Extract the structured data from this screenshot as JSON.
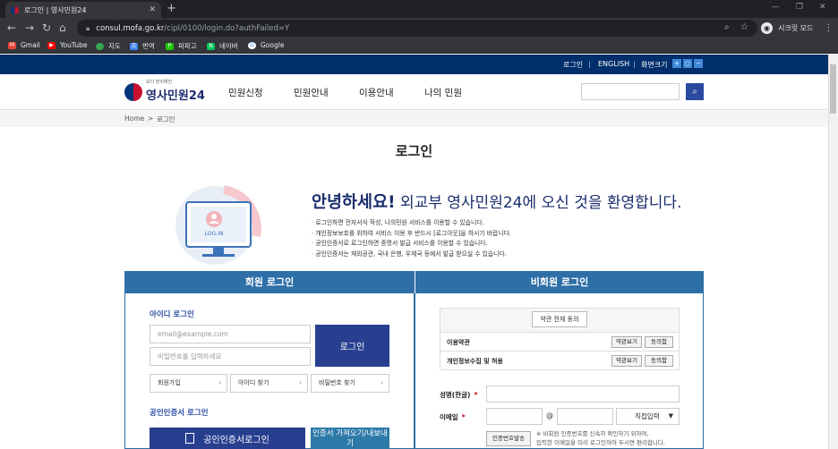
{
  "browser": {
    "tab_title": "로그인 | 영사민원24",
    "url_host": "consul.mofa.go.kr",
    "url_path": "/cipl/0100/login.do?authFailed=Y",
    "incognito_label": "시크릿 모드",
    "bookmarks": [
      "Gmail",
      "YouTube",
      "지도",
      "번역",
      "파파고",
      "네이버",
      "Google"
    ]
  },
  "util": {
    "login": "로그인",
    "english": "ENGLISH",
    "zoom": "화면크기",
    "sep": "|"
  },
  "header": {
    "logo_small": "보다 편리해진",
    "logo_text": "영사민원24",
    "nav": [
      "민원신청",
      "민원안내",
      "이용안내",
      "나의 민원"
    ]
  },
  "breadcrumb": {
    "home": "Home",
    "sep": ">",
    "current": "로그인"
  },
  "page_title": "로그인",
  "intro": {
    "illus_label": "LOG-IN",
    "hello": "안녕하세요!",
    "welcome_rest": " 외교부 영사민원24에 오신 것을 환영합니다.",
    "notes": [
      "로그인하면 전자서식 작성, 나의민원 서비스를 이용할 수 있습니다.",
      "개인정보보호를 위하여 서비스 이용 후 반드시 [로그아웃]을 하시기 바랍니다.",
      "공인인증서로 로그인하면 증명서 발급 서비스를 이용할 수 있습니다.",
      "공인인증서는 재외공관, 국내 은행, 우체국 등에서 발급 받으실 수 있습니다."
    ]
  },
  "member": {
    "heading": "회원 로그인",
    "id_login_title": "아이디 로그인",
    "id_placeholder": "email@example.com",
    "pw_placeholder": "비밀번호를 입력하세요",
    "login_button": "로그인",
    "links": [
      "회원가입",
      "아이디 찾기",
      "비밀번호 찾기"
    ],
    "cert_title": "공인인증서 로그인",
    "cert_button": "공인인증서로그인",
    "cert_button2": "인증서 가져오기/내보내기"
  },
  "guest": {
    "heading": "비회원 로그인",
    "agree_all": "약관 전체 동의",
    "terms": [
      {
        "label": "이용약관",
        "view": "약관보기",
        "agree": "동의함"
      },
      {
        "label": "개인정보수집 및 허용",
        "view": "약관보기",
        "agree": "동의함"
      }
    ],
    "name_label": "성명(한글)",
    "required_mark": "*",
    "email_label": "이메일",
    "at": "@",
    "domain_select": "직접입력",
    "send_code": "인증번호발송",
    "note_lines": [
      "※ 비회원 인증번호를 신속히 확인하기 위하여,",
      "입력한 이메일을 미리 로그인하여 두시면 편리합니다."
    ]
  }
}
